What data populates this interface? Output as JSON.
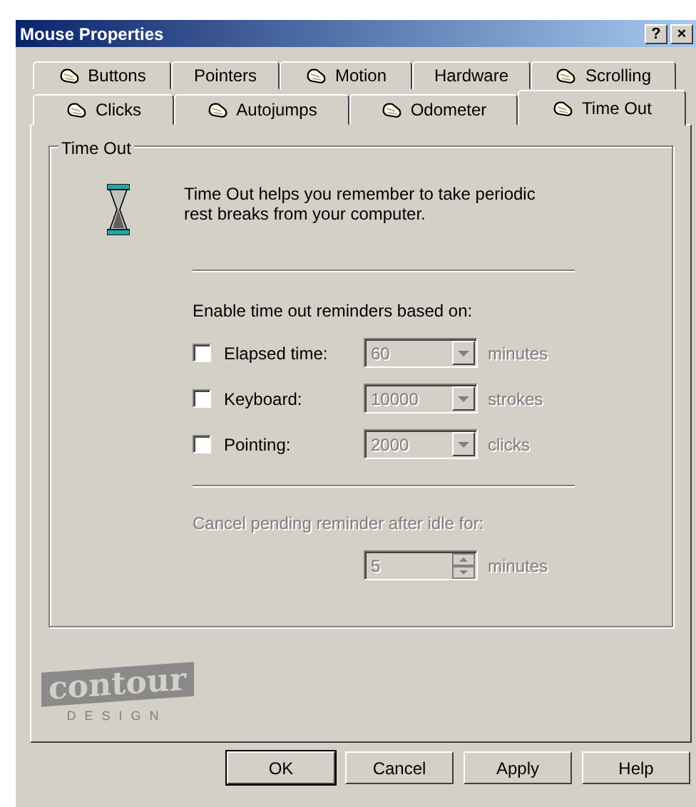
{
  "window": {
    "title": "Mouse Properties",
    "title_buttons": [
      "?",
      "×"
    ]
  },
  "tabs": [
    [
      {
        "label": "Buttons",
        "icon": true,
        "selected": false
      },
      {
        "label": "Pointers",
        "icon": false,
        "selected": false
      },
      {
        "label": "Motion",
        "icon": true,
        "selected": false
      },
      {
        "label": "Hardware",
        "icon": false,
        "selected": false
      },
      {
        "label": "Scrolling",
        "icon": true,
        "selected": false
      }
    ],
    [
      {
        "label": "Clicks",
        "icon": true,
        "selected": false
      },
      {
        "label": "Autojumps",
        "icon": true,
        "selected": false
      },
      {
        "label": "Odometer",
        "icon": true,
        "selected": false
      },
      {
        "label": "Time Out",
        "icon": true,
        "selected": true
      }
    ]
  ],
  "group": {
    "title": "Time Out",
    "description": "Time Out helps you remember to take periodic rest breaks from your computer.",
    "reminders_label": "Enable time out reminders based on:",
    "reminders": [
      {
        "label": "Elapsed time:",
        "checked": false,
        "value": "60",
        "unit": "minutes",
        "disabled": true
      },
      {
        "label": "Keyboard:",
        "checked": false,
        "value": "10000",
        "unit": "strokes",
        "disabled": true
      },
      {
        "label": "Pointing:",
        "checked": false,
        "value": "2000",
        "unit": "clicks",
        "disabled": true
      }
    ],
    "idle": {
      "label": "Cancel pending reminder after idle for:",
      "value": "5",
      "unit": "minutes",
      "disabled": true
    }
  },
  "logo": {
    "word": "contour",
    "tagline": "DESIGN"
  },
  "buttons": [
    {
      "label": "OK",
      "default": true
    },
    {
      "label": "Cancel",
      "default": false
    },
    {
      "label": "Apply",
      "default": false
    },
    {
      "label": "Help",
      "default": false
    }
  ]
}
